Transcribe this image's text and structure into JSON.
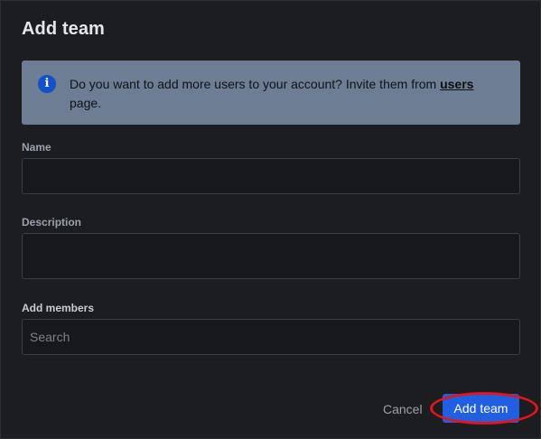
{
  "dialog": {
    "title": "Add team"
  },
  "info_banner": {
    "text_before": "Do you want to add more users to your account? Invite them from ",
    "link_text": "users",
    "text_after": " page.",
    "icon": "info-icon"
  },
  "fields": {
    "name": {
      "label": "Name",
      "value": "",
      "placeholder": ""
    },
    "description": {
      "label": "Description",
      "value": "",
      "placeholder": ""
    },
    "members": {
      "label": "Add members",
      "value": "",
      "placeholder": "Search"
    }
  },
  "actions": {
    "cancel_label": "Cancel",
    "submit_label": "Add team"
  },
  "colors": {
    "accent": "#1f5fe0",
    "banner": "#6d7d93",
    "annotation": "#e3141a"
  }
}
